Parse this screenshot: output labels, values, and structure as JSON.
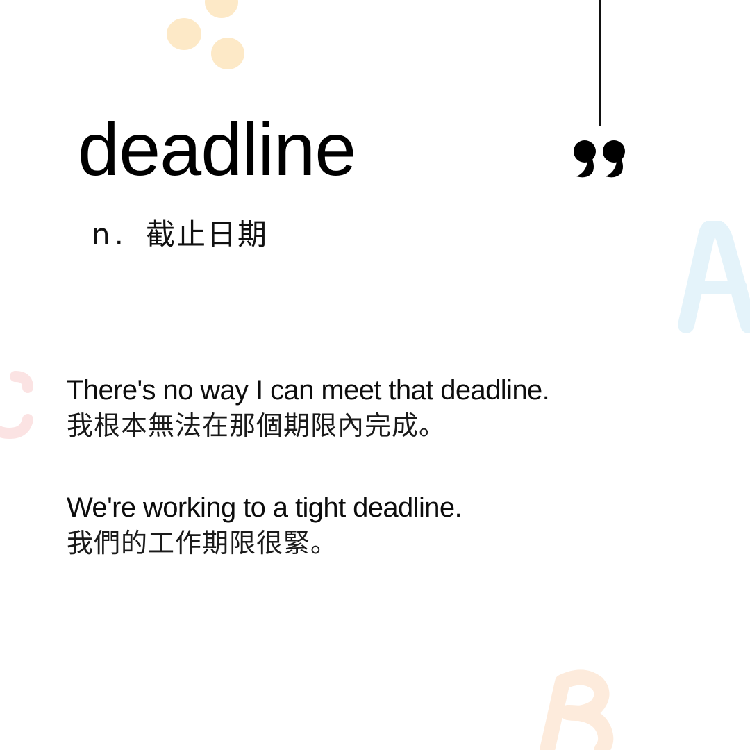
{
  "word": {
    "headword": "deadline",
    "part_of_speech": "n.",
    "translation": "截止日期"
  },
  "examples": [
    {
      "english": "There's no way I can meet that deadline.",
      "chinese": "我根本無法在那個期限內完成。"
    },
    {
      "english": "We're working to a tight deadline.",
      "chinese": "我們的工作期限很緊。"
    }
  ],
  "decor": {
    "quote_icon": "closing-quote-icon",
    "letter_a": "A",
    "letter_b": "B",
    "letter_c": "C",
    "colors": {
      "dots": "#fde9c7",
      "letter_a": "#e4f3fa",
      "letter_b": "#fdebdc",
      "letter_c": "#fbe3e3",
      "ink": "#000000"
    }
  }
}
